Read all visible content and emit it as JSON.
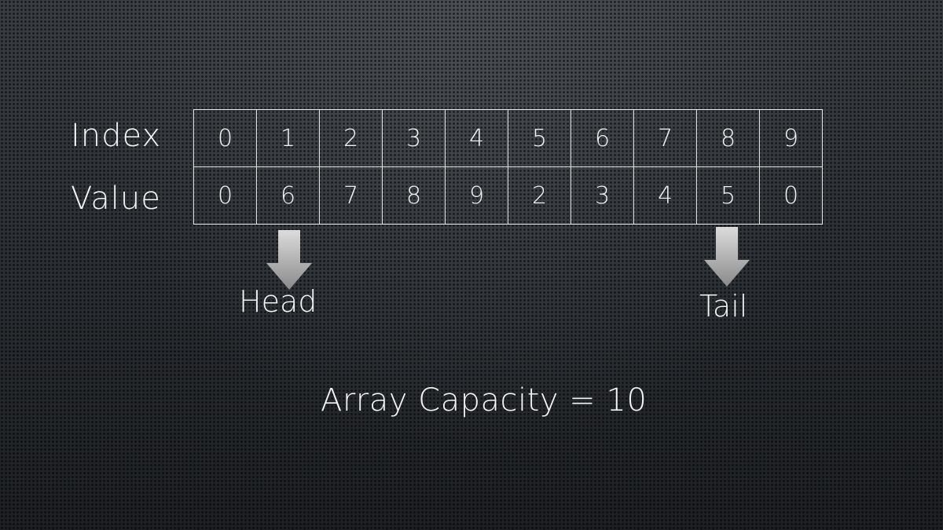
{
  "row_labels": {
    "index": "Index",
    "value": "Value"
  },
  "array": {
    "indices": [
      "0",
      "1",
      "2",
      "3",
      "4",
      "5",
      "6",
      "7",
      "8",
      "9"
    ],
    "values": [
      "0",
      "6",
      "7",
      "8",
      "9",
      "2",
      "3",
      "4",
      "5",
      "0"
    ]
  },
  "pointers": {
    "head": {
      "label": "Head",
      "index": 1
    },
    "tail": {
      "label": "Tail",
      "index": 8
    }
  },
  "capacity_text": "Array Capacity = 10",
  "colors": {
    "grid": "#e6e6e6",
    "text": "#f4f4f4",
    "arrow_light": "#d9d9d9",
    "arrow_dark": "#8c8c8c"
  }
}
